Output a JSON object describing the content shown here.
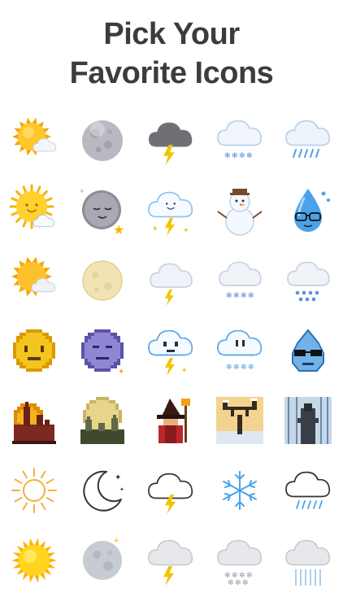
{
  "headline": {
    "line1": "Pick Your",
    "line2": "Favorite Icons"
  },
  "icon_rows": [
    {
      "style": "glossy",
      "icons": [
        "sun-behind-cloud-icon",
        "full-moon-icon",
        "lightning-cloud-icon",
        "snow-cloud-icon",
        "rain-cloud-icon"
      ]
    },
    {
      "style": "cute",
      "icons": [
        "smiling-sun-icon",
        "sleepy-moon-icon",
        "happy-lightning-cloud-icon",
        "snowman-icon",
        "raindrop-with-glasses-icon"
      ]
    },
    {
      "style": "flat",
      "icons": [
        "sun-cloud-icon",
        "moon-icon",
        "cloud-lightning-icon",
        "cloud-snow-icon",
        "cloud-rain-icon"
      ]
    },
    {
      "style": "pixel-character",
      "icons": [
        "pixel-sun-face-icon",
        "pixel-moon-face-icon",
        "pixel-storm-cloud-face-icon",
        "pixel-snow-cloud-face-icon",
        "pixel-raindrop-glasses-icon"
      ]
    },
    {
      "style": "pixel-scene",
      "icons": [
        "pixel-castle-sunset-icon",
        "pixel-graveyard-moon-icon",
        "pixel-wizard-icon",
        "pixel-winter-tree-icon",
        "pixel-rain-figure-icon"
      ]
    },
    {
      "style": "line",
      "icons": [
        "line-sun-icon",
        "line-crescent-moon-icon",
        "line-cloud-lightning-icon",
        "line-snowflake-icon",
        "line-cloud-rain-icon"
      ]
    },
    {
      "style": "realistic",
      "icons": [
        "bright-sun-icon",
        "grey-moon-icon",
        "grey-cloud-lightning-icon",
        "grey-cloud-snow-icon",
        "grey-cloud-rain-icon"
      ]
    }
  ],
  "colors": {
    "headline": "#3c3c3c",
    "sun": "#f7b500",
    "cloud": "#e7eef8",
    "blue": "#5aa0e8",
    "bolt": "#f2c500"
  }
}
